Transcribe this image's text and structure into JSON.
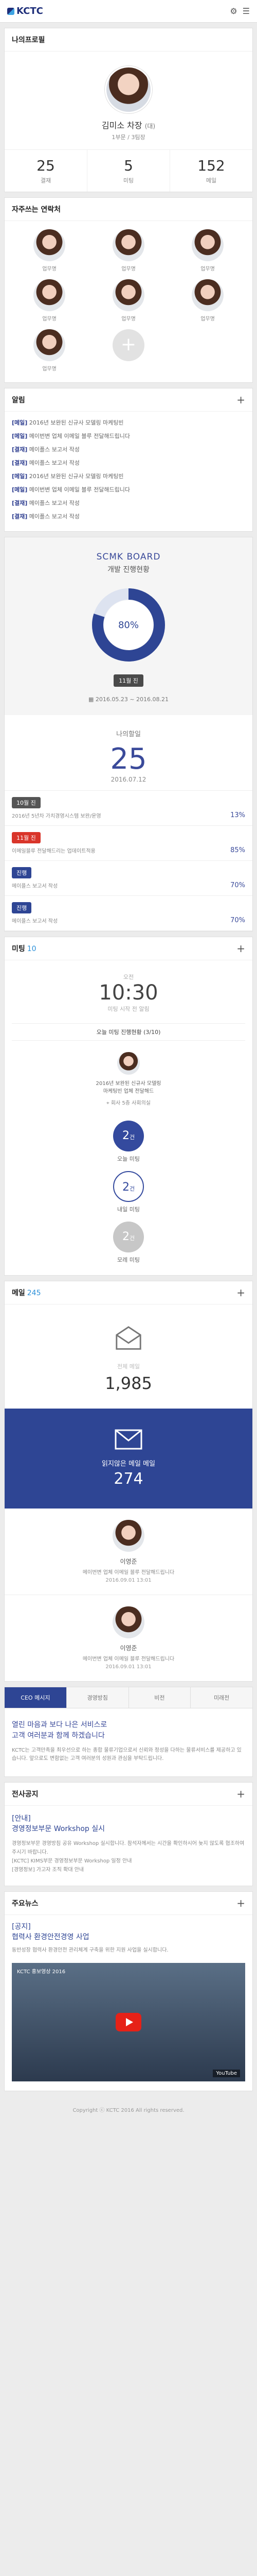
{
  "header": {
    "logo": "KCTC",
    "icons": [
      "gear-icon",
      "menu-icon"
    ]
  },
  "profile": {
    "title": "나의프로필",
    "name": "김미소 차장",
    "degree": "(대)",
    "dept": "1부문 / 3팀장",
    "stats": [
      {
        "value": "25",
        "label": "결재"
      },
      {
        "value": "5",
        "label": "미팅"
      },
      {
        "value": "152",
        "label": "메일"
      }
    ]
  },
  "contacts": {
    "title": "자주쓰는 연락처",
    "people": [
      "업무명",
      "업무명",
      "업무명",
      "업무명",
      "업무명",
      "업무명",
      "업무명"
    ]
  },
  "alarm": {
    "title": "알림",
    "items": [
      {
        "tag": "[메일]",
        "text": "2016년 보완된 신규사 모델링 마케팅빈"
      },
      {
        "tag": "[메일]",
        "text": "메이번변 업체 이메일 블루 전달해드립니다"
      },
      {
        "tag": "[결재]",
        "text": "메이플스 보고서 작성"
      },
      {
        "tag": "[결재]",
        "text": "메이플스 보고서 작성"
      },
      {
        "tag": "[메일]",
        "text": "2016년 보완된 신규사 모델링 마케팅빈"
      },
      {
        "tag": "[메일]",
        "text": "메이번변 업체 이메일 블루 전달해드립니다"
      },
      {
        "tag": "[결재]",
        "text": "메이플스 보고서 작성"
      },
      {
        "tag": "[결재]",
        "text": "메이플스 보고서 작성"
      }
    ]
  },
  "board": {
    "title": "SCMK BOARD",
    "subtitle": "개발 진행현황",
    "percent": 80,
    "percent_label": "80%",
    "badge": "11월 진",
    "period": "2016.05.23 ~ 2016.08.21"
  },
  "mytask": {
    "label": "나의할일",
    "value": "25",
    "date": "2016.07.12",
    "tasks": [
      {
        "pill": "10월 진",
        "color": "#555555",
        "text": "2016년 5년차 가치경영시스템 보완/운영",
        "pct": "13%"
      },
      {
        "pill": "11월 진",
        "color": "#d9352a",
        "text": "이메일블루 전달해드리는 업데이트적용",
        "pct": "85%"
      },
      {
        "pill": "진행",
        "color": "#2e4594",
        "text": "메이플스 보고서 작성",
        "pct": "70%"
      },
      {
        "pill": "진행",
        "color": "#2e4594",
        "text": "메이플스 보고서 작성",
        "pct": "70%"
      }
    ]
  },
  "meeting": {
    "title": "미팅",
    "count": "10",
    "time_label": "오전",
    "time": "10:30",
    "time_sub": "미팅 시작 전 알림",
    "status": "오늘 미팅 진행현황 (3/10)",
    "person_text": "2016년 보완된 신규사 모델링\n마케팅빈 업체 전달해드",
    "location": "회사 5층 사회의실",
    "circles": [
      {
        "value": "2",
        "unit": "건",
        "label": "오늘 미팅"
      },
      {
        "value": "2",
        "unit": "건",
        "label": "내일 미팅"
      },
      {
        "value": "2",
        "unit": "건",
        "label": "모레 미팅"
      }
    ]
  },
  "mail": {
    "title": "메일",
    "count": "245",
    "total_label": "전체 메일",
    "total": "1,985",
    "unread_label": "읽지않은 메일 메일",
    "unread": "274",
    "items": [
      {
        "name": "이영준",
        "msg": "메이번변 업체 이메일 블루 전달해드립니다",
        "date": "2016.09.01  13:01"
      },
      {
        "name": "이영준",
        "msg": "메이번변 업체 이메일 블루 전달해드립니다",
        "date": "2016.09.01  13:01"
      }
    ]
  },
  "tabs": {
    "labels": [
      "CEO 메시지",
      "경영방침",
      "비전",
      "미래전"
    ],
    "headline": "열린 마음과 보다 나은 서비스로\n고객 여러분과 함께 하겠습니다",
    "body": "KCTC는 고객만족을 최우선으로 하는 종합 물류기업으로서 신뢰와 정성을 다하는 물류서비스를 제공하고 있습니다. 앞으로도 변함없는 고객 여러분의 성원과 관심을 부탁드립니다."
  },
  "notice": {
    "title": "전사공지",
    "headline": "[안내]\n경영정보부문 Workshop 실시",
    "body": "경영정보부문 경영방침 공유 Workshop 실시합니다. 참석자께서는 시간을 확인하시어 늦지 않도록 협조하여 주시기 바랍니다.\n[KCTC] KIMS부문 경영정보부문 Workshop 일정 안내\n[경영정보] 가고자 조직 확대 안내"
  },
  "news": {
    "title": "주요뉴스",
    "headline": "[공지]\n협력사 환경안전경영 사업",
    "body": "동반성장 협력사 환경안전 관리체계 구축을 위한 지원 사업을 실시합니다.",
    "video_title": "KCTC 홍보영상 2016",
    "video_brand": "YouTube"
  },
  "footer": {
    "copyright": "Copyright ⓒ KCTC 2016 All rights reserved."
  }
}
